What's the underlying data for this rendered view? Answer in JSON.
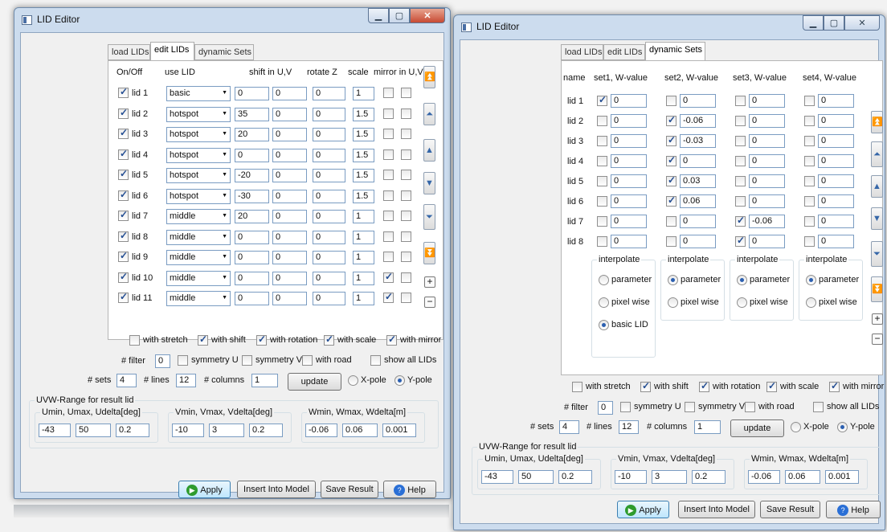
{
  "left": {
    "title": "LID Editor",
    "tabs": [
      "load LIDs",
      "edit LIDs",
      "dynamic Sets"
    ],
    "headers": {
      "onoff": "On/Off",
      "use": "use LID",
      "shift": "shift in U,V",
      "rot": "rotate Z",
      "scale": "scale",
      "mirror": "mirror in U,V"
    },
    "rows": [
      {
        "label": "lid 1",
        "on": true,
        "use": "basic",
        "u": "0",
        "v": "0",
        "rot": "0",
        "scale": "1",
        "mu": false,
        "mv": false
      },
      {
        "label": "lid 2",
        "on": true,
        "use": "hotspot",
        "u": "35",
        "v": "0",
        "rot": "0",
        "scale": "1.5",
        "mu": false,
        "mv": false
      },
      {
        "label": "lid 3",
        "on": true,
        "use": "hotspot",
        "u": "20",
        "v": "0",
        "rot": "0",
        "scale": "1.5",
        "mu": false,
        "mv": false
      },
      {
        "label": "lid 4",
        "on": true,
        "use": "hotspot",
        "u": "0",
        "v": "0",
        "rot": "0",
        "scale": "1.5",
        "mu": false,
        "mv": false
      },
      {
        "label": "lid 5",
        "on": true,
        "use": "hotspot",
        "u": "-20",
        "v": "0",
        "rot": "0",
        "scale": "1.5",
        "mu": false,
        "mv": false
      },
      {
        "label": "lid 6",
        "on": true,
        "use": "hotspot",
        "u": "-30",
        "v": "0",
        "rot": "0",
        "scale": "1.5",
        "mu": false,
        "mv": false
      },
      {
        "label": "lid 7",
        "on": true,
        "use": "middle",
        "u": "20",
        "v": "0",
        "rot": "0",
        "scale": "1",
        "mu": false,
        "mv": false
      },
      {
        "label": "lid 8",
        "on": true,
        "use": "middle",
        "u": "0",
        "v": "0",
        "rot": "0",
        "scale": "1",
        "mu": false,
        "mv": false
      },
      {
        "label": "lid 9",
        "on": true,
        "use": "middle",
        "u": "0",
        "v": "0",
        "rot": "0",
        "scale": "1",
        "mu": false,
        "mv": false
      },
      {
        "label": "lid 10",
        "on": true,
        "use": "middle",
        "u": "0",
        "v": "0",
        "rot": "0",
        "scale": "1",
        "mu": true,
        "mv": false
      },
      {
        "label": "lid 11",
        "on": true,
        "use": "middle",
        "u": "0",
        "v": "0",
        "rot": "0",
        "scale": "1",
        "mu": true,
        "mv": false
      }
    ],
    "options": {
      "checks": [
        {
          "label": "with stretch",
          "on": false
        },
        {
          "label": "with shift",
          "on": true
        },
        {
          "label": "with rotation",
          "on": true
        },
        {
          "label": "with scale",
          "on": true
        },
        {
          "label": "with mirror",
          "on": true
        }
      ],
      "filter_label": "# filter",
      "filter": "0",
      "checks2": [
        {
          "label": "symmetry U",
          "on": false
        },
        {
          "label": "symmetry V",
          "on": false
        },
        {
          "label": "with road",
          "on": false
        },
        {
          "label": "show all LIDs",
          "on": false
        }
      ],
      "sets_label": "# sets",
      "sets": "4",
      "lines_label": "# lines",
      "lines": "12",
      "cols_label": "# columns",
      "cols": "1",
      "update": "update",
      "xpole": "X-pole",
      "ypole": "Y-pole"
    },
    "uvw": {
      "title": "UVW-Range for result lid",
      "u": {
        "title": "Umin, Umax, Udelta[deg]",
        "vals": [
          "-43",
          "50",
          "0.2"
        ]
      },
      "v": {
        "title": "Vmin, Vmax, Vdelta[deg]",
        "vals": [
          "-10",
          "3",
          "0.2"
        ]
      },
      "w": {
        "title": "Wmin, Wmax, Wdelta[m]",
        "vals": [
          "-0.06",
          "0.06",
          "0.001"
        ]
      }
    },
    "buttons": {
      "apply": "Apply",
      "insert": "Insert Into Model",
      "save": "Save Result",
      "help": "Help"
    }
  },
  "right": {
    "title": "LID Editor",
    "tabs": [
      "load LIDs",
      "edit LIDs",
      "dynamic Sets"
    ],
    "headers": {
      "name": "name",
      "s1": "set1, W-value",
      "s2": "set2, W-value",
      "s3": "set3, W-value",
      "s4": "set4, W-value"
    },
    "rows": [
      {
        "label": "lid 1",
        "c": [
          true,
          false,
          false,
          false
        ],
        "v": [
          "0",
          "0",
          "0",
          "0"
        ]
      },
      {
        "label": "lid 2",
        "c": [
          false,
          true,
          false,
          false
        ],
        "v": [
          "0",
          "-0.06",
          "0",
          "0"
        ]
      },
      {
        "label": "lid 3",
        "c": [
          false,
          true,
          false,
          false
        ],
        "v": [
          "0",
          "-0.03",
          "0",
          "0"
        ]
      },
      {
        "label": "lid 4",
        "c": [
          false,
          true,
          false,
          false
        ],
        "v": [
          "0",
          "0",
          "0",
          "0"
        ]
      },
      {
        "label": "lid 5",
        "c": [
          false,
          true,
          false,
          false
        ],
        "v": [
          "0",
          "0.03",
          "0",
          "0"
        ]
      },
      {
        "label": "lid 6",
        "c": [
          false,
          true,
          false,
          false
        ],
        "v": [
          "0",
          "0.06",
          "0",
          "0"
        ]
      },
      {
        "label": "lid 7",
        "c": [
          false,
          false,
          true,
          false
        ],
        "v": [
          "0",
          "0",
          "-0.06",
          "0"
        ]
      },
      {
        "label": "lid 8",
        "c": [
          false,
          false,
          true,
          false
        ],
        "v": [
          "0",
          "0",
          "0",
          "0"
        ]
      }
    ],
    "interp": {
      "title": "interpolate",
      "parameter": "parameter",
      "pixel": "pixel wise",
      "basic": "basic LID"
    },
    "buttons": {
      "apply": "Apply",
      "insert": "Insert Into Model",
      "save": "Save Result",
      "help": "Help"
    }
  }
}
